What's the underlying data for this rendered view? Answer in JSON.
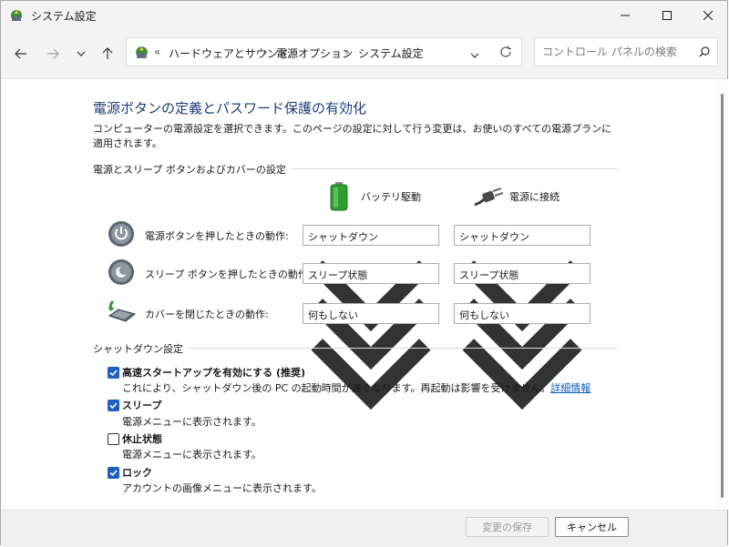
{
  "window": {
    "title": "システム設定"
  },
  "address": {
    "overflow": "«",
    "crumbs": [
      "ハードウェアとサウンド",
      "電源オプション",
      "システム設定"
    ],
    "separator": "›"
  },
  "search": {
    "placeholder": "コントロール パネルの検索"
  },
  "page": {
    "heading": "電源ボタンの定義とパスワード保護の有効化",
    "description": "コンピューターの電源設定を選択できます。このページの設定に対して行う変更は、お使いのすべての電源プランに適用されます。"
  },
  "power_section": {
    "title": "電源とスリープ ボタンおよびカバーの設定",
    "col_battery": "バッテリ駆動",
    "col_plugged": "電源に接続",
    "rows": [
      {
        "label": "電源ボタンを押したときの動作:",
        "icon": "power-button-icon",
        "battery": "シャットダウン",
        "plugged": "シャットダウン"
      },
      {
        "label": "スリープ ボタンを押したときの動作:",
        "icon": "sleep-button-icon",
        "battery": "スリープ状態",
        "plugged": "スリープ状態"
      },
      {
        "label": "カバーを閉じたときの動作:",
        "icon": "laptop-lid-icon",
        "battery": "何もしない",
        "plugged": "何もしない"
      }
    ]
  },
  "shutdown_section": {
    "title": "シャットダウン設定",
    "items": [
      {
        "label": "高速スタートアップを有効にする (推奨)",
        "checked": true,
        "desc": "これにより、シャットダウン後の PC の起動時間が速くなります。再起動は影響を受けません。",
        "link": "詳細情報"
      },
      {
        "label": "スリープ",
        "checked": true,
        "desc": "電源メニューに表示されます。"
      },
      {
        "label": "休止状態",
        "checked": false,
        "desc": "電源メニューに表示されます。"
      },
      {
        "label": "ロック",
        "checked": true,
        "desc": "アカウントの画像メニューに表示されます。"
      }
    ]
  },
  "footer": {
    "save": "変更の保存",
    "cancel": "キャンセル"
  },
  "colors": {
    "heading": "#1e3c78",
    "accent": "#1f5fbf",
    "link": "#0a5dc2"
  }
}
